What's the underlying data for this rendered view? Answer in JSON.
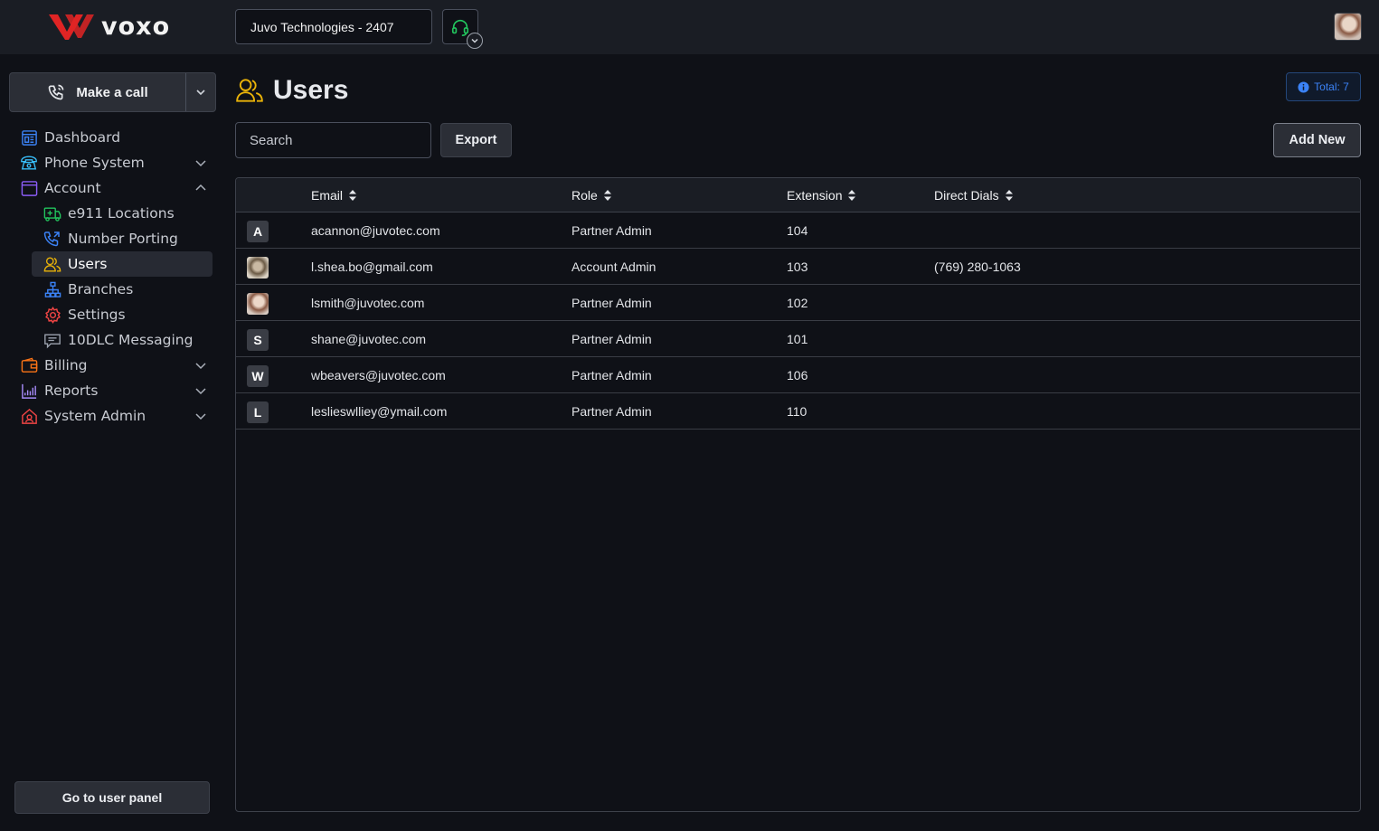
{
  "header": {
    "brand": "voxo",
    "tenant": "Juvo Technologies - 2407"
  },
  "sidebar": {
    "make_call": "Make a call",
    "items": [
      {
        "label": "Dashboard",
        "icon": "dashboard-icon"
      },
      {
        "label": "Phone System",
        "icon": "phone-system-icon"
      },
      {
        "label": "Account",
        "icon": "account-icon"
      },
      {
        "label": "e911 Locations",
        "icon": "e911-icon"
      },
      {
        "label": "Number Porting",
        "icon": "number-porting-icon"
      },
      {
        "label": "Users",
        "icon": "users-icon"
      },
      {
        "label": "Branches",
        "icon": "branches-icon"
      },
      {
        "label": "Settings",
        "icon": "settings-icon"
      },
      {
        "label": "10DLC Messaging",
        "icon": "message-icon"
      },
      {
        "label": "Billing",
        "icon": "billing-icon"
      },
      {
        "label": "Reports",
        "icon": "reports-icon"
      },
      {
        "label": "System Admin",
        "icon": "system-admin-icon"
      }
    ],
    "go_user_panel": "Go to user panel"
  },
  "main": {
    "title": "Users",
    "total": "Total: 7",
    "search_placeholder": "Search",
    "export": "Export",
    "add_new": "Add New"
  },
  "table": {
    "columns": [
      "Email",
      "Role",
      "Extension",
      "Direct Dials"
    ],
    "rows": [
      {
        "avatar": "A",
        "email": "acannon@juvotec.com",
        "role": "Partner Admin",
        "ext": "104",
        "dial": ""
      },
      {
        "avatar": "",
        "email": "l.shea.bo@gmail.com",
        "role": "Account Admin",
        "ext": "103",
        "dial": "(769) 280-1063"
      },
      {
        "avatar": "",
        "email": "lsmith@juvotec.com",
        "role": "Partner Admin",
        "ext": "102",
        "dial": ""
      },
      {
        "avatar": "S",
        "email": "shane@juvotec.com",
        "role": "Partner Admin",
        "ext": "101",
        "dial": ""
      },
      {
        "avatar": "W",
        "email": "wbeavers@juvotec.com",
        "role": "Partner Admin",
        "ext": "106",
        "dial": ""
      },
      {
        "avatar": "L",
        "email": "leslieswlliey@ymail.com",
        "role": "Partner Admin",
        "ext": "110",
        "dial": ""
      }
    ]
  },
  "colors": {
    "background": "#0f1117",
    "topbar": "#1a1d24",
    "brand_red": "#e02424",
    "accent_blue": "#3b82f6",
    "users_yellow": "#eab308"
  }
}
